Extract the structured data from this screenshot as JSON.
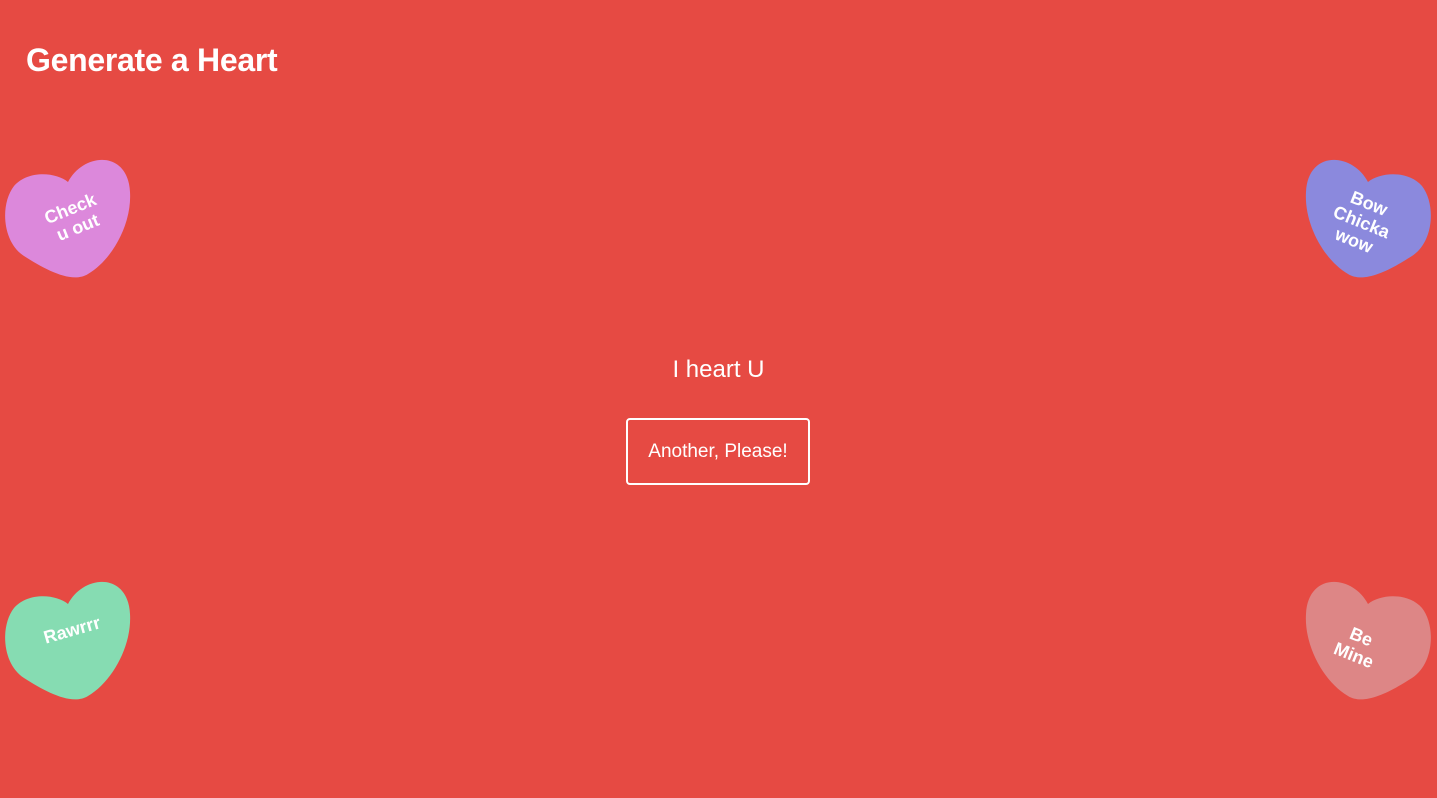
{
  "page": {
    "title": "Generate a Heart",
    "message": "I heart U",
    "button_label": "Another, Please!"
  },
  "hearts": [
    {
      "text": "Check\nu out",
      "color": "#dc88db"
    },
    {
      "text": "Bow\nChicka\nwow",
      "color": "#8b89dd"
    },
    {
      "text": "Rawrrr",
      "color": "#86dcb2"
    },
    {
      "text": "Be\nMine",
      "color": "#dd8686"
    }
  ],
  "colors": {
    "background": "#e64a43",
    "text": "#ffffff"
  }
}
